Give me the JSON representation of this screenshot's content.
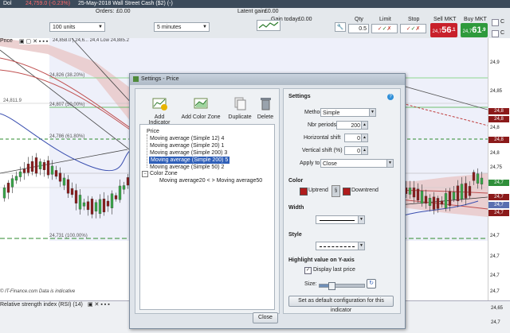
{
  "topbar": {
    "instrument_left": "Dol",
    "price_change": "24,759.0 (-0.23%)",
    "date_market": "25-May-2018   Wall Street Cash ($2) (-)"
  },
  "trading_bar": {
    "units_value": "100 units",
    "interval_value": "5 minutes",
    "orders_label": "Orders:",
    "orders_value": "£0.00",
    "latent_gain_label": "Latent gain:",
    "latent_gain_value": "£0.00",
    "gain_today_label": "Gain today:",
    "gain_today_value": "£0.00",
    "qty_label": "Qty",
    "qty_value": "0.5",
    "limit_label": "Limit",
    "stop_label": "Stop",
    "sell_label": "Sell MKT",
    "sell_price_small": "24,7",
    "sell_price_big": "56",
    "sell_price_sup": ".1",
    "buy_label": "Buy MKT",
    "buy_price_small": "24,7",
    "buy_price_big": "61",
    "buy_price_sup": ".9",
    "edge_letters": [
      "C",
      "C"
    ]
  },
  "chart": {
    "panel_label": "Price",
    "legend_text": "24,858.0 | 24,6... 24,4 Low 24,885.2",
    "level_labels": [
      {
        "text": "24,826 (38.20%)"
      },
      {
        "text": "24,807 (50.00%)"
      },
      {
        "text": "24,786 (61.80%)"
      },
      {
        "text": "24,731 (100.00%)"
      },
      {
        "text": "24,811.9"
      }
    ],
    "watermark": "© IT-Finance.com  Data is indicative",
    "rsi_label": "Relative strength index (RSI) (14)",
    "axis_ticks": [
      "24,9",
      "24,85",
      "24,8",
      "24,8",
      "24,75",
      "24,7",
      "24,7",
      "24,7",
      "24,7",
      "24,65",
      "24,7"
    ],
    "price_badges": [
      "24,8",
      "24,8",
      "24,8",
      "24,7",
      "24,7",
      "24,7",
      "24,7"
    ],
    "badge_colors": [
      "#8b1a1a",
      "#8b1a1a",
      "#8b1a1a",
      "#2f8f3a",
      "#8b1a1a",
      "#5a6fb0",
      "#8b1a1a"
    ]
  },
  "dialog": {
    "title": "Settings - Price",
    "tools": {
      "add_indicator": "Add Indicator",
      "add_color_zone": "Add Color Zone",
      "duplicate": "Duplicate",
      "delete": "Delete"
    },
    "tree": {
      "root": "Price",
      "items": [
        "Moving average (Simple 12) 4",
        "Moving average (Simple 20) 1",
        "Moving average (Simple 200) 3",
        "Moving average (Simple 200) 5",
        "Moving average (Simple 50) 2"
      ],
      "selected_index": 3,
      "color_zone_label": "Color Zone",
      "color_zone_child": "Moving average20 < > Moving average50"
    },
    "settings": {
      "header": "Settings",
      "method_label": "Method",
      "method_value": "Simple",
      "periods_label": "Nbr periods",
      "periods_value": "200",
      "hshift_label": "Horizontal shift",
      "hshift_value": "0",
      "vshift_label": "Vertical shift (%)",
      "vshift_value": "0",
      "apply_label": "Apply to",
      "apply_value": "Close",
      "color_header": "Color",
      "uptrend_label": "Uptrend",
      "downtrend_label": "Downtrend",
      "uptrend_color": "#b01c1c",
      "downtrend_color": "#b01c1c",
      "width_header": "Width",
      "style_header": "Style",
      "highlight_header": "Highlight value on Y-axis",
      "display_last_price_label": "Display last price",
      "display_last_price_checked": true,
      "size_label": "Size:",
      "size_value": 0.25,
      "default_button": "Set as default configuration for this indicator"
    },
    "close_button": "Close"
  }
}
